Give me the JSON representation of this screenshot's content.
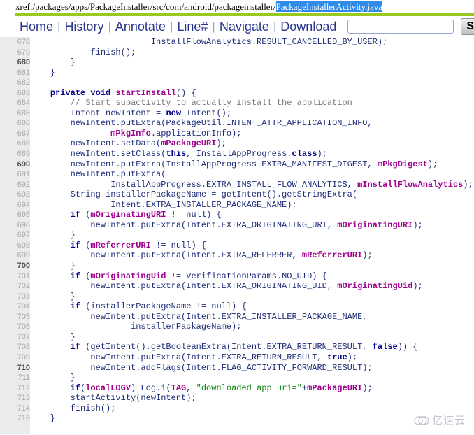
{
  "header": {
    "label": "xref:",
    "path": "/packages/apps/PackageInstaller/src/com/android/packageinstaller/",
    "highlighted_file": "PackageInstallerActivity.java",
    "rule_color": "#9ac81e",
    "highlight_bg": "#2f8ae8"
  },
  "menubar": {
    "links": [
      {
        "label": "Home"
      },
      {
        "label": "History"
      },
      {
        "label": "Annotate"
      },
      {
        "label": "Line#"
      },
      {
        "label": "Navigate"
      },
      {
        "label": "Download"
      }
    ],
    "separator": "|",
    "search": {
      "value": "",
      "placeholder": ""
    },
    "search_button_label": "Search"
  },
  "code": {
    "first_line": 678,
    "lines": [
      {
        "n": 678,
        "tokens": [
          {
            "t": "plain",
            "v": "                        InstallFlowAnalytics.RESULT_CANCELLED_BY_USER);"
          }
        ]
      },
      {
        "n": 679,
        "tokens": [
          {
            "t": "plain",
            "v": "            finish();"
          }
        ]
      },
      {
        "n": 680,
        "tokens": [
          {
            "t": "plain",
            "v": "        }"
          }
        ]
      },
      {
        "n": 681,
        "tokens": [
          {
            "t": "plain",
            "v": "    }"
          }
        ]
      },
      {
        "n": 682,
        "tokens": [
          {
            "t": "plain",
            "v": ""
          }
        ]
      },
      {
        "n": 683,
        "tokens": [
          {
            "t": "plain",
            "v": "    "
          },
          {
            "t": "keyword",
            "v": "private void "
          },
          {
            "t": "ident",
            "v": "startInstall"
          },
          {
            "t": "plain",
            "v": "() {"
          }
        ]
      },
      {
        "n": 684,
        "tokens": [
          {
            "t": "plain",
            "v": "        "
          },
          {
            "t": "comment",
            "v": "// Start subactivity to actually install the application"
          }
        ]
      },
      {
        "n": 685,
        "tokens": [
          {
            "t": "plain",
            "v": "        Intent newIntent = "
          },
          {
            "t": "keyword",
            "v": "new"
          },
          {
            "t": "plain",
            "v": " Intent();"
          }
        ]
      },
      {
        "n": 686,
        "tokens": [
          {
            "t": "plain",
            "v": "        newIntent.putExtra(PackageUtil.INTENT_ATTR_APPLICATION_INFO,"
          }
        ]
      },
      {
        "n": 687,
        "tokens": [
          {
            "t": "plain",
            "v": "                "
          },
          {
            "t": "ident",
            "v": "mPkgInfo"
          },
          {
            "t": "plain",
            "v": ".applicationInfo);"
          }
        ]
      },
      {
        "n": 688,
        "tokens": [
          {
            "t": "plain",
            "v": "        newIntent.setData("
          },
          {
            "t": "ident",
            "v": "mPackageURI"
          },
          {
            "t": "plain",
            "v": ");"
          }
        ]
      },
      {
        "n": 689,
        "tokens": [
          {
            "t": "plain",
            "v": "        newIntent.setClass("
          },
          {
            "t": "keyword",
            "v": "this"
          },
          {
            "t": "plain",
            "v": ", InstallAppProgress."
          },
          {
            "t": "keyword",
            "v": "class"
          },
          {
            "t": "plain",
            "v": ");"
          }
        ]
      },
      {
        "n": 690,
        "tokens": [
          {
            "t": "plain",
            "v": "        newIntent.putExtra(InstallAppProgress.EXTRA_MANIFEST_DIGEST, "
          },
          {
            "t": "ident",
            "v": "mPkgDigest"
          },
          {
            "t": "plain",
            "v": ");"
          }
        ]
      },
      {
        "n": 691,
        "tokens": [
          {
            "t": "plain",
            "v": "        newIntent.putExtra("
          }
        ]
      },
      {
        "n": 692,
        "tokens": [
          {
            "t": "plain",
            "v": "                InstallAppProgress.EXTRA_INSTALL_FLOW_ANALYTICS, "
          },
          {
            "t": "ident",
            "v": "mInstallFlowAnalytics"
          },
          {
            "t": "plain",
            "v": ");"
          }
        ]
      },
      {
        "n": 693,
        "tokens": [
          {
            "t": "plain",
            "v": "        String installerPackageName = getIntent().getStringExtra("
          }
        ]
      },
      {
        "n": 694,
        "tokens": [
          {
            "t": "plain",
            "v": "                Intent.EXTRA_INSTALLER_PACKAGE_NAME);"
          }
        ]
      },
      {
        "n": 695,
        "tokens": [
          {
            "t": "plain",
            "v": "        "
          },
          {
            "t": "keyword",
            "v": "if"
          },
          {
            "t": "plain",
            "v": " ("
          },
          {
            "t": "ident",
            "v": "mOriginatingURI"
          },
          {
            "t": "plain",
            "v": " != null) {"
          }
        ]
      },
      {
        "n": 696,
        "tokens": [
          {
            "t": "plain",
            "v": "            newIntent.putExtra(Intent.EXTRA_ORIGINATING_URI, "
          },
          {
            "t": "ident",
            "v": "mOriginatingURI"
          },
          {
            "t": "plain",
            "v": ");"
          }
        ]
      },
      {
        "n": 697,
        "tokens": [
          {
            "t": "plain",
            "v": "        }"
          }
        ]
      },
      {
        "n": 698,
        "tokens": [
          {
            "t": "plain",
            "v": "        "
          },
          {
            "t": "keyword",
            "v": "if"
          },
          {
            "t": "plain",
            "v": " ("
          },
          {
            "t": "ident",
            "v": "mReferrerURI"
          },
          {
            "t": "plain",
            "v": " != null) {"
          }
        ]
      },
      {
        "n": 699,
        "tokens": [
          {
            "t": "plain",
            "v": "            newIntent.putExtra(Intent.EXTRA_REFERRER, "
          },
          {
            "t": "ident",
            "v": "mReferrerURI"
          },
          {
            "t": "plain",
            "v": ");"
          }
        ]
      },
      {
        "n": 700,
        "tokens": [
          {
            "t": "plain",
            "v": "        }"
          }
        ]
      },
      {
        "n": 701,
        "tokens": [
          {
            "t": "plain",
            "v": "        "
          },
          {
            "t": "keyword",
            "v": "if"
          },
          {
            "t": "plain",
            "v": " ("
          },
          {
            "t": "ident",
            "v": "mOriginatingUid"
          },
          {
            "t": "plain",
            "v": " != VerificationParams.NO_UID) {"
          }
        ]
      },
      {
        "n": 702,
        "tokens": [
          {
            "t": "plain",
            "v": "            newIntent.putExtra(Intent.EXTRA_ORIGINATING_UID, "
          },
          {
            "t": "ident",
            "v": "mOriginatingUid"
          },
          {
            "t": "plain",
            "v": ");"
          }
        ]
      },
      {
        "n": 703,
        "tokens": [
          {
            "t": "plain",
            "v": "        }"
          }
        ]
      },
      {
        "n": 704,
        "tokens": [
          {
            "t": "plain",
            "v": "        "
          },
          {
            "t": "keyword",
            "v": "if"
          },
          {
            "t": "plain",
            "v": " (installerPackageName != null) {"
          }
        ]
      },
      {
        "n": 705,
        "tokens": [
          {
            "t": "plain",
            "v": "            newIntent.putExtra(Intent.EXTRA_INSTALLER_PACKAGE_NAME,"
          }
        ]
      },
      {
        "n": 706,
        "tokens": [
          {
            "t": "plain",
            "v": "                    installerPackageName);"
          }
        ]
      },
      {
        "n": 707,
        "tokens": [
          {
            "t": "plain",
            "v": "        }"
          }
        ]
      },
      {
        "n": 708,
        "tokens": [
          {
            "t": "plain",
            "v": "        "
          },
          {
            "t": "keyword",
            "v": "if"
          },
          {
            "t": "plain",
            "v": " (getIntent().getBooleanExtra(Intent.EXTRA_RETURN_RESULT, "
          },
          {
            "t": "keyword",
            "v": "false"
          },
          {
            "t": "plain",
            "v": ")) {"
          }
        ]
      },
      {
        "n": 709,
        "tokens": [
          {
            "t": "plain",
            "v": "            newIntent.putExtra(Intent.EXTRA_RETURN_RESULT, "
          },
          {
            "t": "keyword",
            "v": "true"
          },
          {
            "t": "plain",
            "v": ");"
          }
        ]
      },
      {
        "n": 710,
        "tokens": [
          {
            "t": "plain",
            "v": "            newIntent.addFlags(Intent.FLAG_ACTIVITY_FORWARD_RESULT);"
          }
        ]
      },
      {
        "n": 711,
        "tokens": [
          {
            "t": "plain",
            "v": "        }"
          }
        ]
      },
      {
        "n": 712,
        "tokens": [
          {
            "t": "plain",
            "v": "        "
          },
          {
            "t": "keyword",
            "v": "if"
          },
          {
            "t": "plain",
            "v": "("
          },
          {
            "t": "ident",
            "v": "localLOGV"
          },
          {
            "t": "plain",
            "v": ") Log.i("
          },
          {
            "t": "ident",
            "v": "TAG"
          },
          {
            "t": "plain",
            "v": ", "
          },
          {
            "t": "string",
            "v": "\"downloaded app uri=\""
          },
          {
            "t": "plain",
            "v": "+"
          },
          {
            "t": "ident",
            "v": "mPackageURI"
          },
          {
            "t": "plain",
            "v": ");"
          }
        ]
      },
      {
        "n": 713,
        "tokens": [
          {
            "t": "plain",
            "v": "        startActivity(newIntent);"
          }
        ]
      },
      {
        "n": 714,
        "tokens": [
          {
            "t": "plain",
            "v": "        finish();"
          }
        ]
      },
      {
        "n": 715,
        "tokens": [
          {
            "t": "plain",
            "v": "    }"
          }
        ]
      }
    ],
    "colors": {
      "keyword": "#00008b",
      "identifier": "#a0008f",
      "string": "#128a12",
      "comment": "#777777",
      "plain": "#1f2d7a",
      "gutter_bg": "#ebebeb",
      "gutter_text": "#a8a8a8",
      "gutter_text_decade": "#4d4d4d"
    }
  },
  "watermark": {
    "text": "亿速云",
    "icon": "cloud-icon",
    "color": "#a8adb8"
  }
}
